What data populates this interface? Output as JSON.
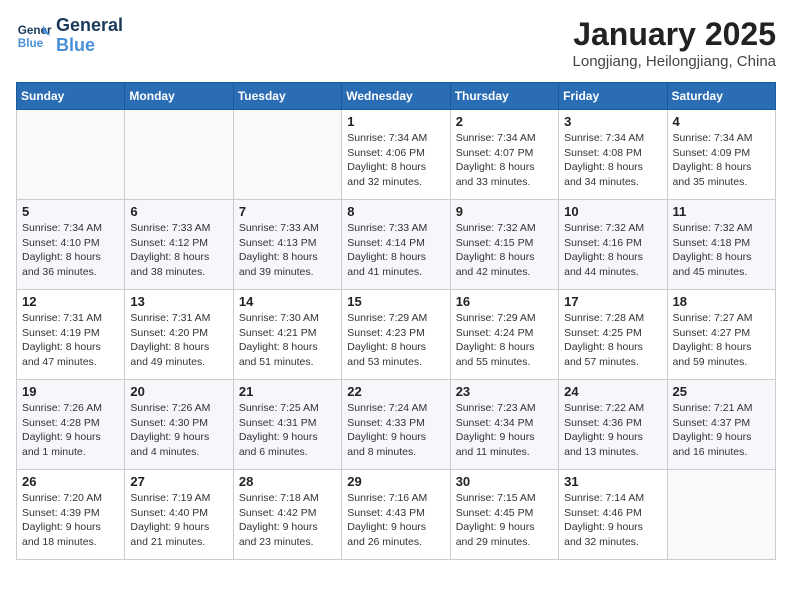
{
  "header": {
    "logo_line1": "General",
    "logo_line2": "Blue",
    "month": "January 2025",
    "location": "Longjiang, Heilongjiang, China"
  },
  "weekdays": [
    "Sunday",
    "Monday",
    "Tuesday",
    "Wednesday",
    "Thursday",
    "Friday",
    "Saturday"
  ],
  "weeks": [
    [
      {
        "day": "",
        "info": ""
      },
      {
        "day": "",
        "info": ""
      },
      {
        "day": "",
        "info": ""
      },
      {
        "day": "1",
        "info": "Sunrise: 7:34 AM\nSunset: 4:06 PM\nDaylight: 8 hours and 32 minutes."
      },
      {
        "day": "2",
        "info": "Sunrise: 7:34 AM\nSunset: 4:07 PM\nDaylight: 8 hours and 33 minutes."
      },
      {
        "day": "3",
        "info": "Sunrise: 7:34 AM\nSunset: 4:08 PM\nDaylight: 8 hours and 34 minutes."
      },
      {
        "day": "4",
        "info": "Sunrise: 7:34 AM\nSunset: 4:09 PM\nDaylight: 8 hours and 35 minutes."
      }
    ],
    [
      {
        "day": "5",
        "info": "Sunrise: 7:34 AM\nSunset: 4:10 PM\nDaylight: 8 hours and 36 minutes."
      },
      {
        "day": "6",
        "info": "Sunrise: 7:33 AM\nSunset: 4:12 PM\nDaylight: 8 hours and 38 minutes."
      },
      {
        "day": "7",
        "info": "Sunrise: 7:33 AM\nSunset: 4:13 PM\nDaylight: 8 hours and 39 minutes."
      },
      {
        "day": "8",
        "info": "Sunrise: 7:33 AM\nSunset: 4:14 PM\nDaylight: 8 hours and 41 minutes."
      },
      {
        "day": "9",
        "info": "Sunrise: 7:32 AM\nSunset: 4:15 PM\nDaylight: 8 hours and 42 minutes."
      },
      {
        "day": "10",
        "info": "Sunrise: 7:32 AM\nSunset: 4:16 PM\nDaylight: 8 hours and 44 minutes."
      },
      {
        "day": "11",
        "info": "Sunrise: 7:32 AM\nSunset: 4:18 PM\nDaylight: 8 hours and 45 minutes."
      }
    ],
    [
      {
        "day": "12",
        "info": "Sunrise: 7:31 AM\nSunset: 4:19 PM\nDaylight: 8 hours and 47 minutes."
      },
      {
        "day": "13",
        "info": "Sunrise: 7:31 AM\nSunset: 4:20 PM\nDaylight: 8 hours and 49 minutes."
      },
      {
        "day": "14",
        "info": "Sunrise: 7:30 AM\nSunset: 4:21 PM\nDaylight: 8 hours and 51 minutes."
      },
      {
        "day": "15",
        "info": "Sunrise: 7:29 AM\nSunset: 4:23 PM\nDaylight: 8 hours and 53 minutes."
      },
      {
        "day": "16",
        "info": "Sunrise: 7:29 AM\nSunset: 4:24 PM\nDaylight: 8 hours and 55 minutes."
      },
      {
        "day": "17",
        "info": "Sunrise: 7:28 AM\nSunset: 4:25 PM\nDaylight: 8 hours and 57 minutes."
      },
      {
        "day": "18",
        "info": "Sunrise: 7:27 AM\nSunset: 4:27 PM\nDaylight: 8 hours and 59 minutes."
      }
    ],
    [
      {
        "day": "19",
        "info": "Sunrise: 7:26 AM\nSunset: 4:28 PM\nDaylight: 9 hours and 1 minute."
      },
      {
        "day": "20",
        "info": "Sunrise: 7:26 AM\nSunset: 4:30 PM\nDaylight: 9 hours and 4 minutes."
      },
      {
        "day": "21",
        "info": "Sunrise: 7:25 AM\nSunset: 4:31 PM\nDaylight: 9 hours and 6 minutes."
      },
      {
        "day": "22",
        "info": "Sunrise: 7:24 AM\nSunset: 4:33 PM\nDaylight: 9 hours and 8 minutes."
      },
      {
        "day": "23",
        "info": "Sunrise: 7:23 AM\nSunset: 4:34 PM\nDaylight: 9 hours and 11 minutes."
      },
      {
        "day": "24",
        "info": "Sunrise: 7:22 AM\nSunset: 4:36 PM\nDaylight: 9 hours and 13 minutes."
      },
      {
        "day": "25",
        "info": "Sunrise: 7:21 AM\nSunset: 4:37 PM\nDaylight: 9 hours and 16 minutes."
      }
    ],
    [
      {
        "day": "26",
        "info": "Sunrise: 7:20 AM\nSunset: 4:39 PM\nDaylight: 9 hours and 18 minutes."
      },
      {
        "day": "27",
        "info": "Sunrise: 7:19 AM\nSunset: 4:40 PM\nDaylight: 9 hours and 21 minutes."
      },
      {
        "day": "28",
        "info": "Sunrise: 7:18 AM\nSunset: 4:42 PM\nDaylight: 9 hours and 23 minutes."
      },
      {
        "day": "29",
        "info": "Sunrise: 7:16 AM\nSunset: 4:43 PM\nDaylight: 9 hours and 26 minutes."
      },
      {
        "day": "30",
        "info": "Sunrise: 7:15 AM\nSunset: 4:45 PM\nDaylight: 9 hours and 29 minutes."
      },
      {
        "day": "31",
        "info": "Sunrise: 7:14 AM\nSunset: 4:46 PM\nDaylight: 9 hours and 32 minutes."
      },
      {
        "day": "",
        "info": ""
      }
    ]
  ]
}
